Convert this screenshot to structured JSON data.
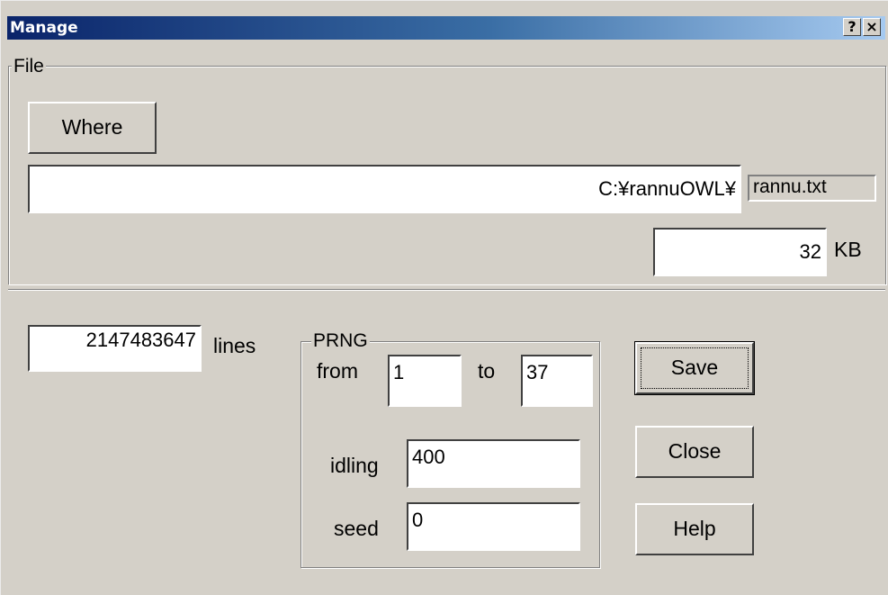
{
  "window": {
    "title": "Manage",
    "help_btn": "?",
    "close_btn": "×"
  },
  "file_group": {
    "label": "File",
    "where_button": "Where",
    "path_value": "C:¥rannuOWL¥",
    "filename": "rannu.txt",
    "size_value": "32",
    "size_unit": "KB"
  },
  "lines": {
    "value": "2147483647",
    "label": "lines"
  },
  "prng": {
    "label": "PRNG",
    "from_label": "from",
    "from_value": "1",
    "to_label": "to",
    "to_value": "37",
    "idling_label": "idling",
    "idling_value": "400",
    "seed_label": "seed",
    "seed_value": "0"
  },
  "buttons": {
    "save": "Save",
    "close": "Close",
    "help": "Help"
  }
}
